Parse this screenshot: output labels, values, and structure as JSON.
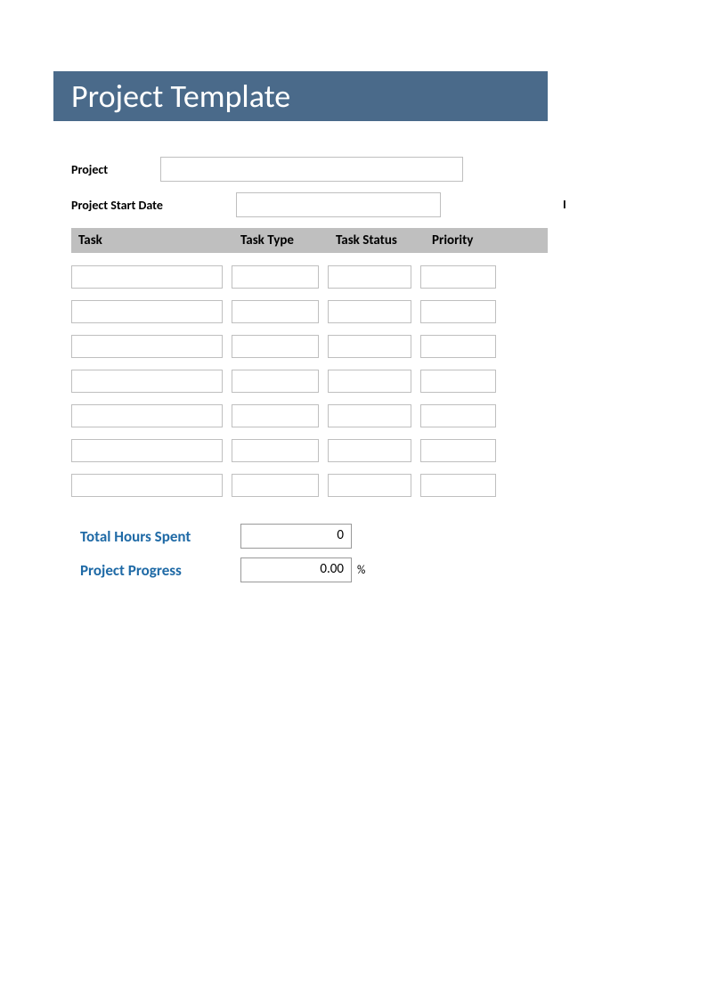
{
  "title": "Project Template",
  "fields": {
    "project_label": "Project",
    "project_value": "",
    "start_date_label": "Project Start Date",
    "start_date_value": ""
  },
  "table": {
    "headers": {
      "task": "Task",
      "task_type": "Task Type",
      "task_status": "Task Status",
      "priority": "Priority"
    },
    "rows": [
      {
        "task": "",
        "type": "",
        "status": "",
        "priority": ""
      },
      {
        "task": "",
        "type": "",
        "status": "",
        "priority": ""
      },
      {
        "task": "",
        "type": "",
        "status": "",
        "priority": ""
      },
      {
        "task": "",
        "type": "",
        "status": "",
        "priority": ""
      },
      {
        "task": "",
        "type": "",
        "status": "",
        "priority": ""
      },
      {
        "task": "",
        "type": "",
        "status": "",
        "priority": ""
      },
      {
        "task": "",
        "type": "",
        "status": "",
        "priority": ""
      }
    ]
  },
  "summary": {
    "total_hours_label": "Total Hours Spent",
    "total_hours_value": "0",
    "progress_label": "Project Progress",
    "progress_value": "0.00",
    "percent_symbol": "%"
  }
}
